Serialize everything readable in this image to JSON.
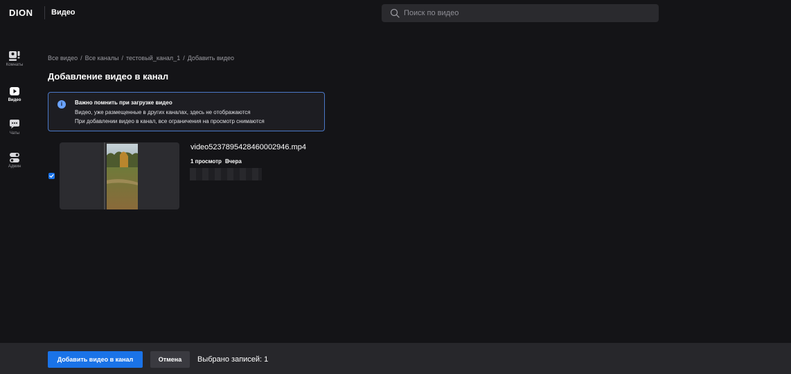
{
  "app": {
    "logo": "DION",
    "title": "Видео"
  },
  "search": {
    "placeholder": "Поиск по видео",
    "value": ""
  },
  "sidebar": {
    "items": [
      {
        "label": "Комнаты",
        "icon": "rooms-icon"
      },
      {
        "label": "Видео",
        "icon": "video-icon",
        "active": true
      },
      {
        "label": "Чаты",
        "icon": "chat-icon"
      },
      {
        "label": "Админ",
        "icon": "admin-icon"
      }
    ]
  },
  "breadcrumb": {
    "items": [
      "Все видео",
      "Все каналы",
      "тестовый_канал_1",
      "Добавить видео"
    ],
    "separator": "/"
  },
  "page": {
    "title": "Добавление видео в канал"
  },
  "info": {
    "icon": "info-icon",
    "title": "Важно помнить при загрузке видео",
    "line1": "Видео, уже размещенные в других каналах, здесь не отображаются",
    "line2": "При добавлении видео в канал, все ограничения на просмотр снимаются"
  },
  "videos": [
    {
      "name": "video5237895428460002946.mp4",
      "views": "1 просмотр",
      "date": "Вчера",
      "selected": true
    }
  ],
  "footer": {
    "add_label": "Добавить видео в канал",
    "cancel_label": "Отмена",
    "selected_text": "Выбрано записей: 1"
  },
  "colors": {
    "background": "#141417",
    "accent": "#1a73e8",
    "info_border": "#4a78c8",
    "footer_bg": "#27272b"
  }
}
